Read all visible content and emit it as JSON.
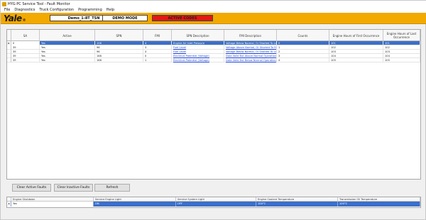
{
  "window": {
    "title": "HYG PC Service Tool - Fault Monitor"
  },
  "menu": [
    "File",
    "Diagnostics",
    "Truck Configuration",
    "Programming",
    "Help"
  ],
  "header": {
    "logo": "Yale",
    "logo_suffix": "®",
    "truck": "Demo_1-8T_TSN",
    "mode": "DEMO MODE",
    "codes": "ACTIVE CODES",
    "codes_color": "#e01818",
    "brand_color": "#f2a900"
  },
  "table": {
    "columns": [
      "SA",
      "Active",
      "SPN",
      "FMI",
      "SPN Description",
      "FMI Description",
      "Counts",
      "Engine Hours of First Occurrence",
      "Engine Hours of Last Occurrence"
    ],
    "rows": [
      {
        "marker": "▸",
        "sa": "0",
        "active": "Yes",
        "spn": "106",
        "fmi": "4",
        "spn_desc": "Engine Air Inlet Pressure",
        "fmi_desc": "Voltage Below Normal, Or Shorted To Lo...",
        "counts": "0",
        "first": "101",
        "last": "101"
      },
      {
        "marker": "",
        "sa": "39",
        "active": "Yes",
        "spn": "96",
        "fmi": "3",
        "spn_desc": "Fuel Level",
        "fmi_desc": "Voltage Above Normal, Or Shorted To H...",
        "counts": "1",
        "first": "102",
        "last": "102"
      },
      {
        "marker": "",
        "sa": "39",
        "active": "Yes",
        "spn": "96",
        "fmi": "4",
        "spn_desc": "Fuel Level",
        "fmi_desc": "Voltage Below Normal, Or Shorted To Lo...",
        "counts": "2",
        "first": "103",
        "last": "103"
      },
      {
        "marker": "",
        "sa": "39",
        "active": "Yes",
        "spn": "168",
        "fmi": "0",
        "spn_desc": "Electrical Potential (Voltage)",
        "fmi_desc": "Data Valid But Above Normal Operationa...",
        "counts": "3",
        "first": "104",
        "last": "104"
      },
      {
        "marker": "",
        "sa": "39",
        "active": "Yes",
        "spn": "168",
        "fmi": "1",
        "spn_desc": "Electrical Potential (Voltage)",
        "fmi_desc": "Data Valid But Below Normal Operational...",
        "counts": "4",
        "first": "105",
        "last": "105"
      }
    ]
  },
  "buttons": {
    "clear_active": "Clear Active Faults",
    "clear_inactive": "Clear Inactive Faults",
    "refresh": "Refresh"
  },
  "status": {
    "columns": [
      "Engine Shutdown",
      "Service Engine Light",
      "Service System Light",
      "Engine Coolant Temperature",
      "Transmission Oil Temperature"
    ],
    "marker": "▸",
    "values": [
      "Yes",
      "ON",
      "OFF",
      "100°C",
      "100°C"
    ]
  }
}
